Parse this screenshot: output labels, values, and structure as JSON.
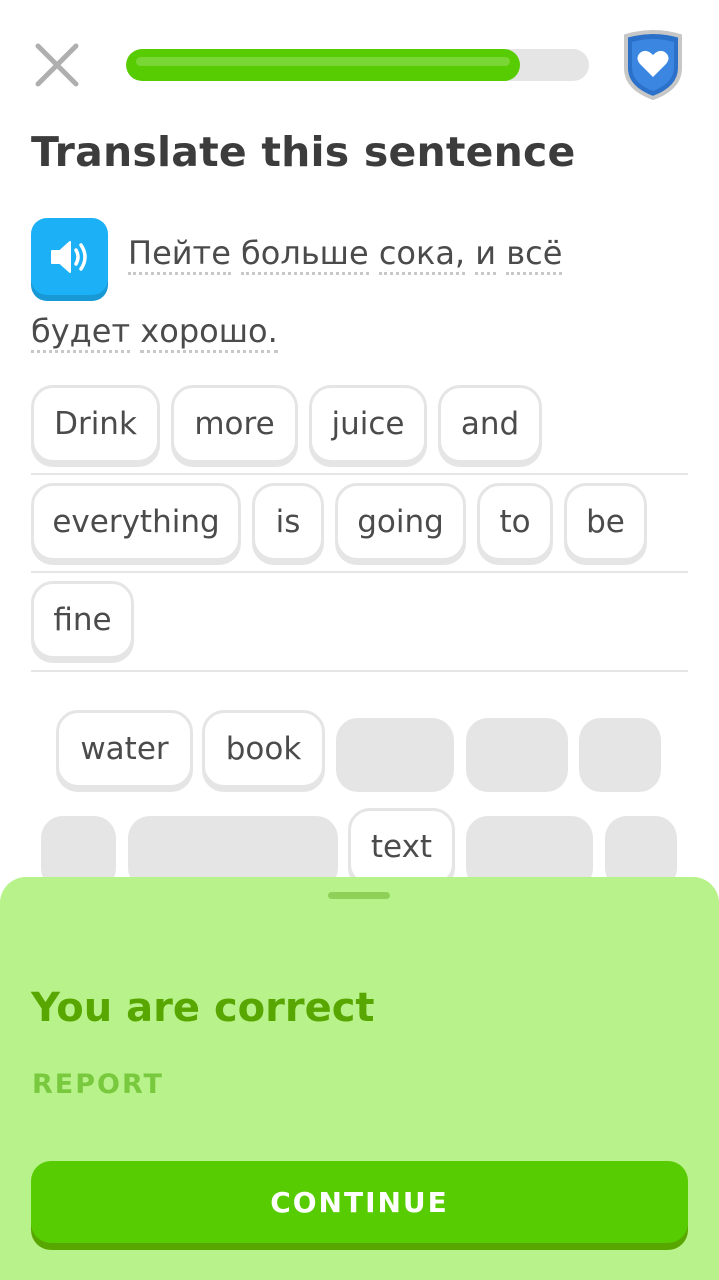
{
  "header": {
    "progress": 0.85,
    "progress_color": "#58cc02",
    "close_icon": "close-icon",
    "hearts_icon": "heart-shield-icon"
  },
  "title": "Translate this sentence",
  "prompt": {
    "speaker_icon": "speaker-icon",
    "line1": [
      "Пейте",
      "больше",
      "сока,",
      "и",
      "всё"
    ],
    "line2": [
      "будет",
      "хорошо."
    ]
  },
  "answer": {
    "row1": [
      "Drink",
      "more",
      "juice",
      "and"
    ],
    "row2": [
      "everything",
      "is",
      "going",
      "to",
      "be"
    ],
    "row3": [
      "fine"
    ]
  },
  "word_bank": {
    "row1": [
      "water",
      "book"
    ],
    "row2": [
      "text"
    ]
  },
  "result": {
    "title": "You are correct",
    "report": "REPORT",
    "continue": "CONTINUE",
    "color": "#58a700",
    "background": "#b8f28b"
  }
}
